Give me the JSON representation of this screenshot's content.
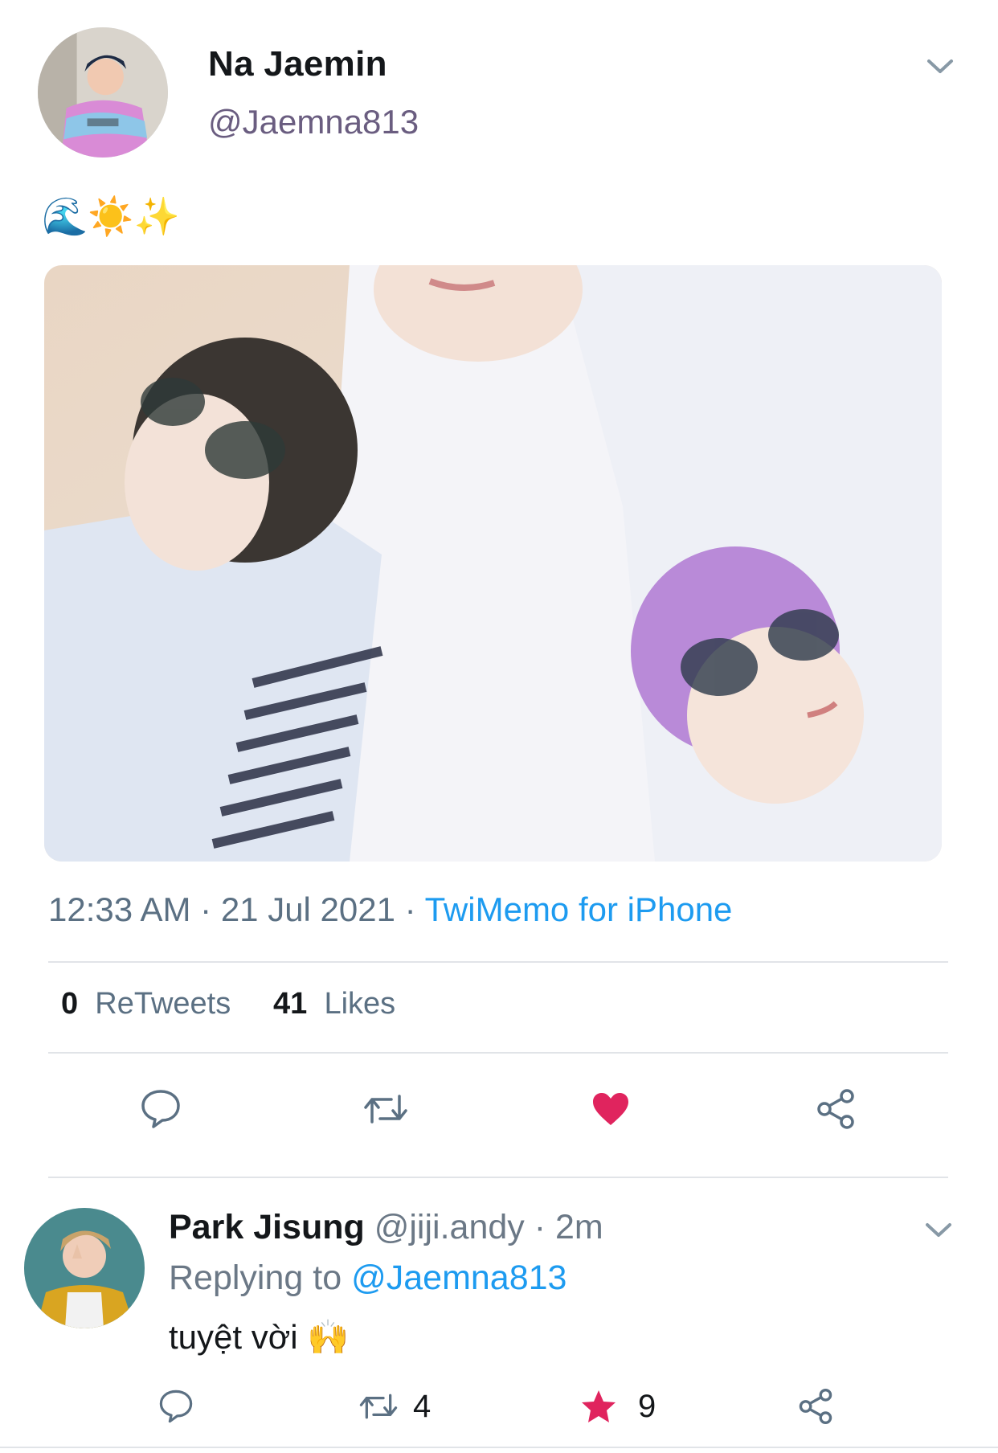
{
  "tweet": {
    "author_name": "Na Jaemin",
    "author_handle": "@Jaemna813",
    "text_emojis": "🌊☀️✨",
    "time": "12:33 AM",
    "date": "21 Jul 2021",
    "separator": "·",
    "source": "TwiMemo for iPhone",
    "retweet_count": "0",
    "retweet_label": "ReTweets",
    "like_count": "41",
    "like_label": "Likes",
    "liked": true
  },
  "actions": {
    "reply_icon": "comment-icon",
    "retweet_icon": "retweet-icon",
    "like_icon": "heart-icon",
    "share_icon": "share-icon",
    "like_color": "#e0245e"
  },
  "reply": {
    "author_name": "Park Jisung",
    "author_handle": "@jiji.andy",
    "separator": "·",
    "time": "2m",
    "replying_to_label": "Replying to",
    "replying_to_handle": "@Jaemna813",
    "text": "tuyệt vời 🙌",
    "retweet_count": "4",
    "favorite_count": "9",
    "favorite_color": "#e0245e"
  },
  "colors": {
    "link": "#1d9bf0",
    "secondary_text": "#5b7083",
    "divider": "#e1e4e8"
  }
}
